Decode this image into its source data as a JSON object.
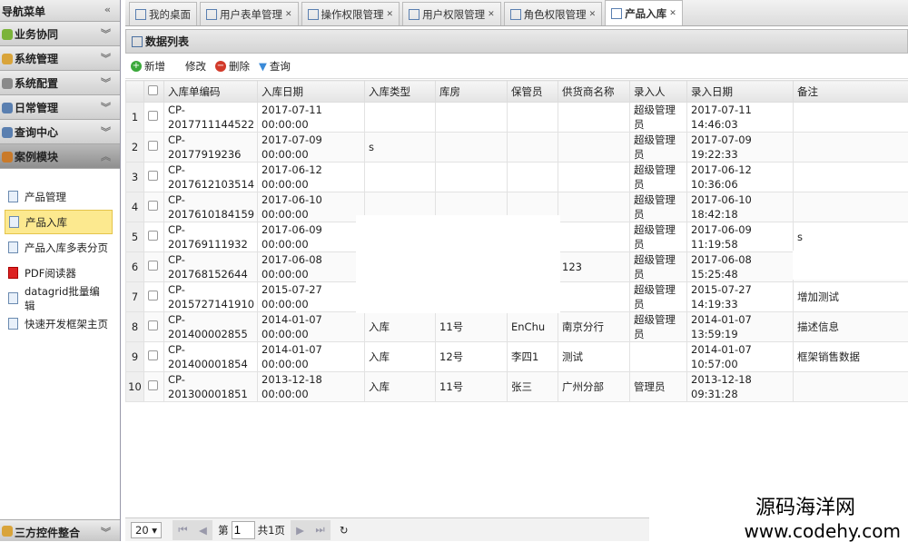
{
  "sidebar": {
    "title": "导航菜单",
    "panels": [
      "业务协同",
      "系统管理",
      "系统配置",
      "日常管理",
      "查询中心",
      "案例模块"
    ],
    "items": [
      "产品管理",
      "产品入库",
      "产品入库多表分页",
      "PDF阅读器",
      "datagrid批量编辑",
      "快速开发框架主页"
    ],
    "footer": "三方控件整合"
  },
  "tabs": [
    {
      "label": "我的桌面"
    },
    {
      "label": "用户表单管理"
    },
    {
      "label": "操作权限管理"
    },
    {
      "label": "用户权限管理"
    },
    {
      "label": "角色权限管理"
    },
    {
      "label": "产品入库"
    }
  ],
  "panel_title": "数据列表",
  "toolbar": {
    "add": "新增",
    "edit": "修改",
    "delete": "删除",
    "query": "查询"
  },
  "columns": [
    "入库单编码",
    "入库日期",
    "入库类型",
    "库房",
    "保管员",
    "供货商名称",
    "录入人",
    "录入日期",
    "备注"
  ],
  "rows": [
    [
      "1",
      "CP-2017711144522",
      "2017-07-11 00:00:00",
      "",
      "",
      "",
      "",
      "超级管理员",
      "2017-07-11 14:46:03",
      ""
    ],
    [
      "2",
      "CP-20177919236",
      "2017-07-09 00:00:00",
      "s",
      "",
      "",
      "",
      "超级管理员",
      "2017-07-09 19:22:33",
      ""
    ],
    [
      "3",
      "CP-2017612103514",
      "2017-06-12 00:00:00",
      "",
      "",
      "",
      "",
      "超级管理员",
      "2017-06-12 10:36:06",
      ""
    ],
    [
      "4",
      "CP-2017610184159",
      "2017-06-10 00:00:00",
      "",
      "",
      "",
      "",
      "超级管理员",
      "2017-06-10 18:42:18",
      ""
    ],
    [
      "5",
      "CP-201769111932",
      "2017-06-09 00:00:00",
      "",
      "",
      "",
      "",
      "超级管理员",
      "2017-06-09 11:19:58",
      "s"
    ],
    [
      "6",
      "CP-201768152644",
      "2017-06-08 00:00:00",
      "",
      "",
      "",
      "123",
      "超级管理员",
      "2017-06-08 15:25:48",
      ""
    ],
    [
      "7",
      "CP-2015727141910",
      "2015-07-27 00:00:00",
      "",
      "",
      "",
      "",
      "超级管理员",
      "2015-07-27 14:19:33",
      "增加测试"
    ],
    [
      "8",
      "CP-201400002855",
      "2014-01-07 00:00:00",
      "入库",
      "11号",
      "EnChu",
      "南京分行",
      "超级管理员",
      "2014-01-07 13:59:19",
      "描述信息"
    ],
    [
      "9",
      "CP-201400001854",
      "2014-01-07 00:00:00",
      "入库",
      "12号",
      "李四1",
      "测试",
      "",
      "2014-01-07 10:57:00",
      "框架销售数据"
    ],
    [
      "10",
      "CP-201300001851",
      "2013-12-18 00:00:00",
      "入库",
      "11号",
      "张三",
      "广州分部",
      "管理员",
      "2013-12-18 09:31:28",
      ""
    ]
  ],
  "pager": {
    "page_size": "20",
    "page_prefix": "第",
    "page": "1",
    "total": "共1页"
  },
  "watermark": {
    "name": "源码海洋网",
    "url": "www.codehy.com"
  }
}
